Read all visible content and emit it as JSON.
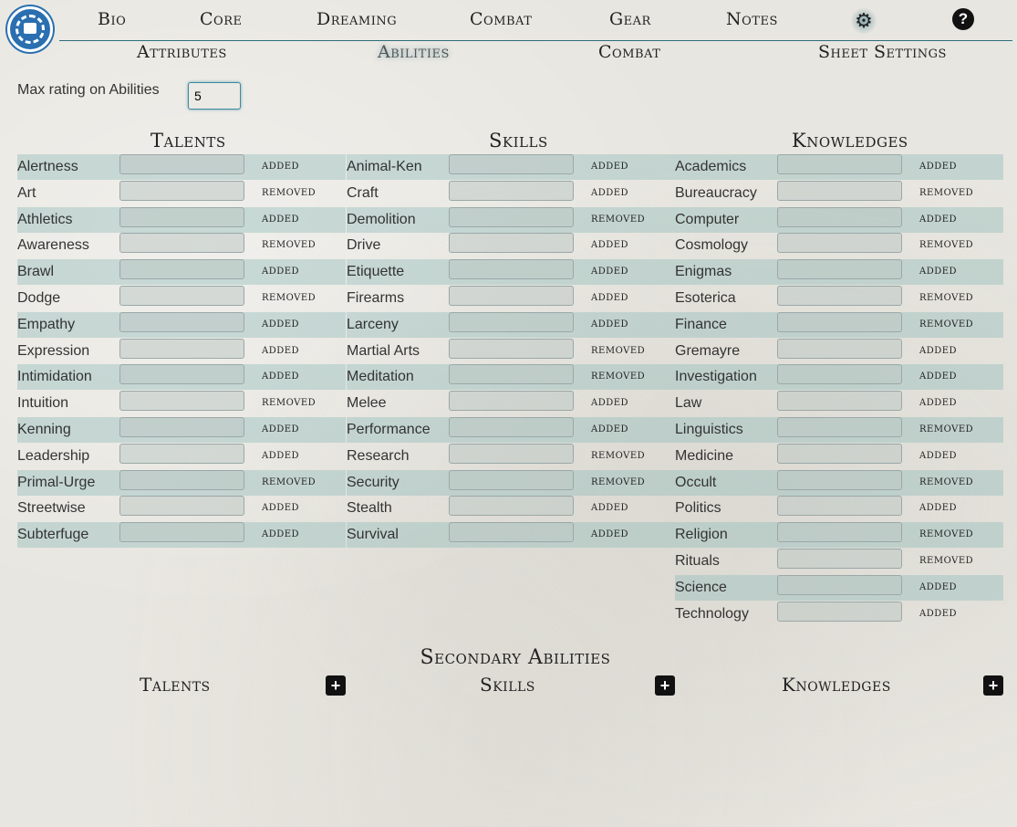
{
  "nav": {
    "tabs": [
      "Bio",
      "Core",
      "Dreaming",
      "Combat",
      "Gear",
      "Notes"
    ],
    "settings_icon": "gear-icon",
    "help_label": "?"
  },
  "subnav": {
    "tabs": [
      "Attributes",
      "Abilities",
      "Combat",
      "Sheet Settings"
    ],
    "active": "Abilities"
  },
  "settings": {
    "max_label": "Max rating on Abilities",
    "max_value": "5"
  },
  "columns": [
    {
      "title": "Talents",
      "rows": [
        {
          "name": "Alertness",
          "state": "added"
        },
        {
          "name": "Art",
          "state": "removed"
        },
        {
          "name": "Athletics",
          "state": "added"
        },
        {
          "name": "Awareness",
          "state": "removed"
        },
        {
          "name": "Brawl",
          "state": "added"
        },
        {
          "name": "Dodge",
          "state": "removed"
        },
        {
          "name": "Empathy",
          "state": "added"
        },
        {
          "name": "Expression",
          "state": "added"
        },
        {
          "name": "Intimidation",
          "state": "added"
        },
        {
          "name": "Intuition",
          "state": "removed"
        },
        {
          "name": "Kenning",
          "state": "added"
        },
        {
          "name": "Leadership",
          "state": "added"
        },
        {
          "name": "Primal-Urge",
          "state": "removed"
        },
        {
          "name": "Streetwise",
          "state": "added"
        },
        {
          "name": "Subterfuge",
          "state": "added"
        }
      ]
    },
    {
      "title": "Skills",
      "rows": [
        {
          "name": "Animal-Ken",
          "state": "added"
        },
        {
          "name": "Craft",
          "state": "added"
        },
        {
          "name": "Demolition",
          "state": "removed"
        },
        {
          "name": "Drive",
          "state": "added"
        },
        {
          "name": "Etiquette",
          "state": "added"
        },
        {
          "name": "Firearms",
          "state": "added"
        },
        {
          "name": "Larceny",
          "state": "added"
        },
        {
          "name": "Martial Arts",
          "state": "removed"
        },
        {
          "name": "Meditation",
          "state": "removed"
        },
        {
          "name": "Melee",
          "state": "added"
        },
        {
          "name": "Performance",
          "state": "added"
        },
        {
          "name": "Research",
          "state": "removed"
        },
        {
          "name": "Security",
          "state": "removed"
        },
        {
          "name": "Stealth",
          "state": "added"
        },
        {
          "name": "Survival",
          "state": "added"
        }
      ]
    },
    {
      "title": "Knowledges",
      "rows": [
        {
          "name": "Academics",
          "state": "added"
        },
        {
          "name": "Bureaucracy",
          "state": "removed"
        },
        {
          "name": "Computer",
          "state": "added"
        },
        {
          "name": "Cosmology",
          "state": "removed"
        },
        {
          "name": "Enigmas",
          "state": "added"
        },
        {
          "name": "Esoterica",
          "state": "removed"
        },
        {
          "name": "Finance",
          "state": "removed"
        },
        {
          "name": "Gremayre",
          "state": "added"
        },
        {
          "name": "Investigation",
          "state": "added"
        },
        {
          "name": "Law",
          "state": "added"
        },
        {
          "name": "Linguistics",
          "state": "removed"
        },
        {
          "name": "Medicine",
          "state": "added"
        },
        {
          "name": "Occult",
          "state": "removed"
        },
        {
          "name": "Politics",
          "state": "added"
        },
        {
          "name": "Religion",
          "state": "removed"
        },
        {
          "name": "Rituals",
          "state": "removed"
        },
        {
          "name": "Science",
          "state": "added"
        },
        {
          "name": "Technology",
          "state": "added"
        }
      ]
    }
  ],
  "secondary": {
    "title": "Secondary Abilities",
    "groups": [
      "Talents",
      "Skills",
      "Knowledges"
    ],
    "add_label": "+"
  }
}
